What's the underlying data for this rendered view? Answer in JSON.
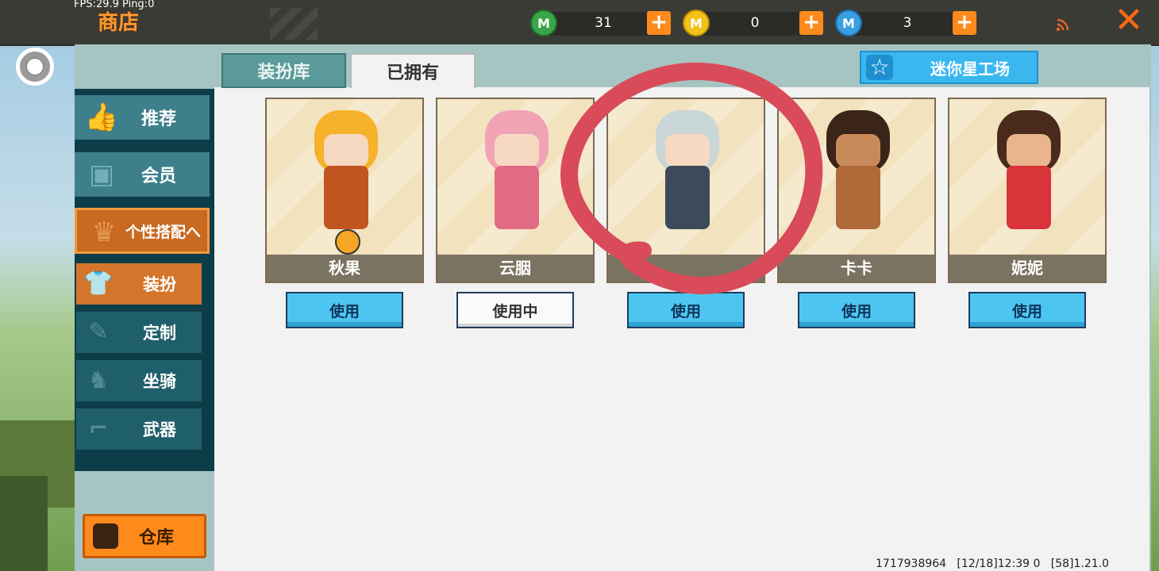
{
  "status": {
    "fps_text": "FPS:29.9  Ping:0"
  },
  "header": {
    "title": "商店",
    "close_icon": "close-icon"
  },
  "currencies": [
    {
      "name": "mini-bean",
      "value": "31",
      "color": "#3aa64a",
      "symbol": "M"
    },
    {
      "name": "mini-coin",
      "value": "0",
      "color": "#f2c21a",
      "symbol": "M"
    },
    {
      "name": "mini-point",
      "value": "3",
      "color": "#3a9fe0",
      "symbol": "M"
    }
  ],
  "tabs": {
    "library": "装扮库",
    "owned": "已拥有"
  },
  "workshop": {
    "label": "迷你星工场"
  },
  "sidebar": {
    "items": [
      {
        "label": "推荐"
      },
      {
        "label": "会员"
      },
      {
        "label": "个性搭配へ"
      }
    ],
    "sub_items": [
      {
        "label": "装扮"
      },
      {
        "label": "定制"
      },
      {
        "label": "坐骑"
      },
      {
        "label": "武器"
      }
    ],
    "warehouse": "仓库"
  },
  "cards": [
    {
      "name": "秋果",
      "button": "使用",
      "in_use": false
    },
    {
      "name": "云胭",
      "button": "使用中",
      "in_use": true
    },
    {
      "name": "",
      "button": "使用",
      "in_use": false
    },
    {
      "name": "卡卡",
      "button": "使用",
      "in_use": false
    },
    {
      "name": "妮妮",
      "button": "使用",
      "in_use": false
    }
  ],
  "footer": {
    "info": "1717938964   [12/18]12:39 0   [58]1.21.0"
  },
  "colors": {
    "accent_orange": "#ff8a1c",
    "annotation_red": "#d94b5a"
  }
}
